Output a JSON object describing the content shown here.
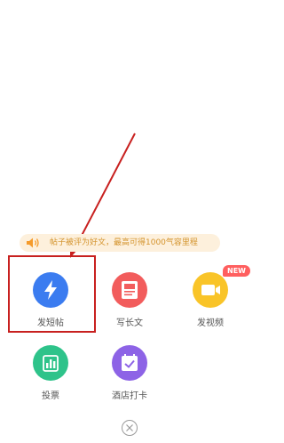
{
  "banner": {
    "text": "帖子被评为好文，最高可得1000气容里程",
    "icon": "speaker-icon"
  },
  "actions": [
    {
      "label": "发短帖",
      "icon": "lightning-icon",
      "color": "#3b7cf0"
    },
    {
      "label": "写长文",
      "icon": "document-image-icon",
      "color": "#f25c5c"
    },
    {
      "label": "发视频",
      "icon": "video-camera-icon",
      "color": "#f9c428",
      "badge": "NEW"
    },
    {
      "label": "投票",
      "icon": "bar-chart-icon",
      "color": "#2ec38a"
    },
    {
      "label": "酒店打卡",
      "icon": "check-in-icon",
      "color": "#8d63e6"
    }
  ],
  "close": {
    "icon": "close-icon"
  },
  "annotation": {
    "highlight_color": "#c8201f"
  }
}
